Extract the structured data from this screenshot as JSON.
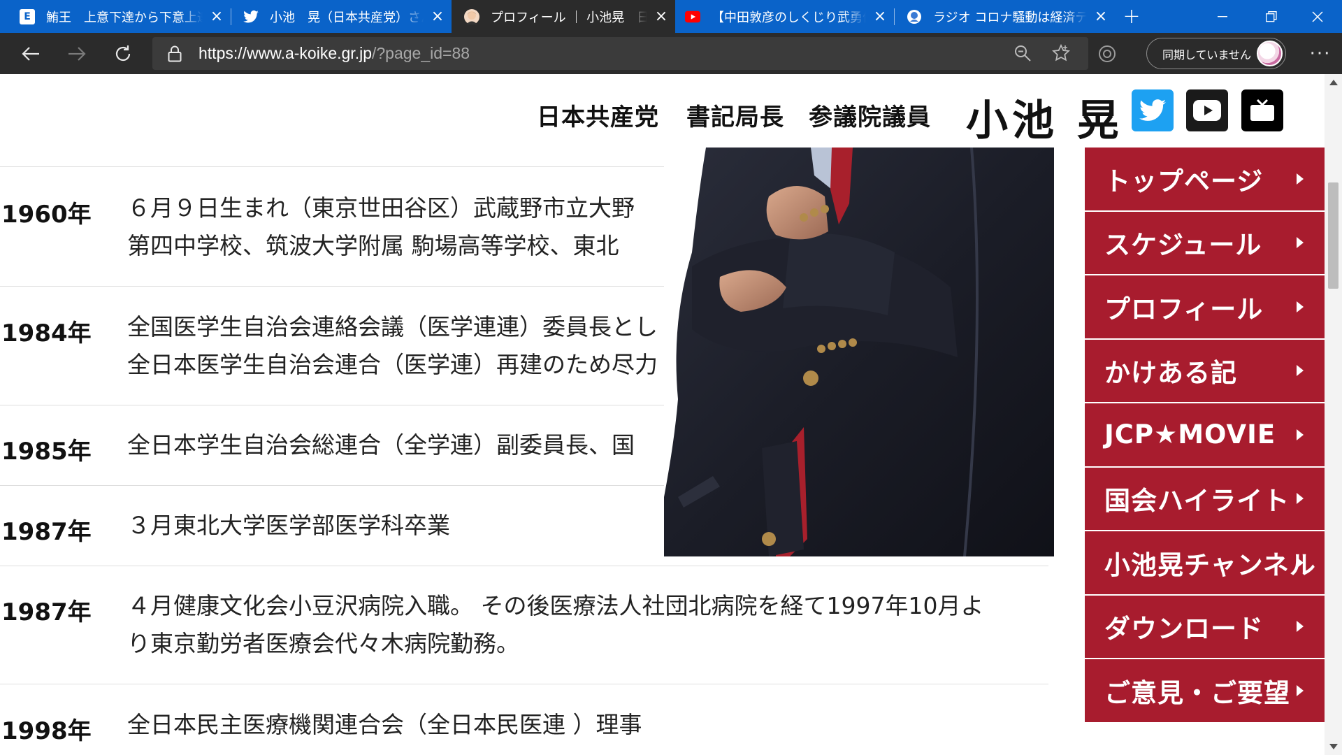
{
  "browser": {
    "tabs": [
      {
        "title": "鮪王　上意下達から下意上達",
        "favicon": "site-e-icon"
      },
      {
        "title": "小池　晃（日本共産党）さん",
        "favicon": "twitter-icon"
      },
      {
        "title": "プロフィール ｜ 小池晃　日本共産党",
        "favicon": "avatar-icon"
      },
      {
        "title": "【中田敦彦のしくじり武勇伝】",
        "favicon": "youtube-icon"
      },
      {
        "title": "ラジオ コロナ騒動は経済テロに",
        "favicon": "radio-icon"
      }
    ],
    "new_tab": "+",
    "url_host": "https://www.a-koike.gr.jp",
    "url_path": "/?page_id=88",
    "sync_label": "同期していません",
    "more": "···"
  },
  "header": {
    "party": "日本共産党",
    "role1": "書記局長",
    "role2": "参議院議員",
    "name": "小池 晃",
    "colors": {
      "twitter": "#1da1f2",
      "youtube": "#1a1a1a",
      "tv": "#000000"
    }
  },
  "timeline": [
    {
      "year": "1960年",
      "lines": [
        "６月９日生まれ（東京世田谷区）武蔵野市立大野",
        "第四中学校、筑波大学附属 駒場高等学校、東北"
      ]
    },
    {
      "year": "1984年",
      "lines": [
        "全国医学生自治会連絡会議（医学連連）委員長とし",
        "全日本医学生自治会連合（医学連）再建のため尽力"
      ]
    },
    {
      "year": "1985年",
      "lines": [
        "全日本学生自治会総連合（全学連）副委員長、国"
      ]
    },
    {
      "year": "1987年",
      "lines": [
        "３月東北大学医学部医学科卒業"
      ]
    },
    {
      "year": "1987年",
      "lines": [
        "４月健康文化会小豆沢病院入職。 その後医療法人社団北病院を経て1997年10月よ",
        "り東京勤労者医療会代々木病院勤務。"
      ]
    },
    {
      "year": "1998年",
      "lines": [
        "全日本民主医療機関連合会（全日本民医連 ）理事"
      ]
    }
  ],
  "nav": {
    "accent": "#a81c2e",
    "items": [
      "トップページ",
      "スケジュール",
      "プロフィール",
      "かけある記",
      "JCP★MOVIE",
      "国会ハイライト",
      "小池晃チャンネル",
      "ダウンロード",
      "ご意見・ご要望"
    ]
  }
}
